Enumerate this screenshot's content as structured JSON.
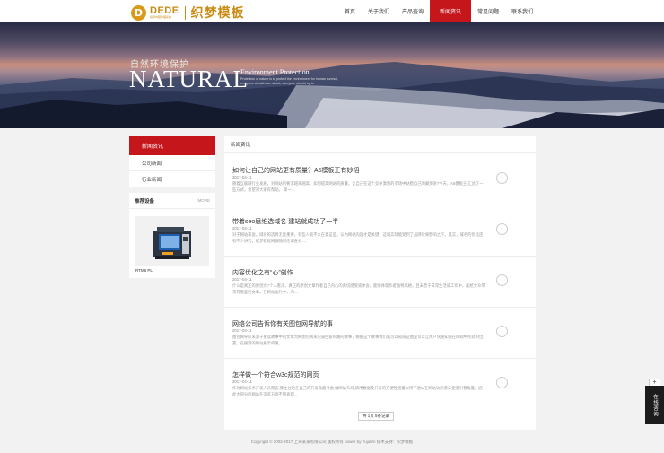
{
  "header": {
    "logo_badge": "D",
    "logo_dede": "DEDE",
    "logo_sub": "织梦内容管理系统",
    "logo_cn": "织梦模板",
    "nav": [
      "首页",
      "关于我们",
      "产品查询",
      "新闻资讯",
      "常见问题",
      "联系我们"
    ],
    "nav_active_index": 3
  },
  "banner": {
    "cn": "自然环境保护",
    "big": "NATURAL",
    "env": "Environment Protection",
    "small": "Protection of nature is to protect the environment for human survival, everyone should care about, everyone should try to"
  },
  "sidebar": {
    "title": "新闻资讯",
    "items": [
      "公司新闻",
      "行业新闻"
    ]
  },
  "recommend": {
    "title": "推荐设备",
    "more": "MORE",
    "product_name": "RTM6 PLI"
  },
  "main": {
    "heading": "新闻资讯",
    "news": [
      {
        "title": "如何让自己的网站更有质量？A5模板王有妙招",
        "date": "2017-04-11",
        "desc": "随着互联网行业发展，对网站的要求越来越高，如何提高网站的质量，让自己在这个竞争激烈的市场中站稳自己的脚步呢?今天，A5模板王 汇总了一些方式，希望对大家有帮助。 第一..."
      },
      {
        "title": "带着seo思维选域名 建站就成功了一半",
        "date": "2017-04-11",
        "desc": "对于网站来说，域名的选择无比重要，有些人就不太在意这些，认为网站内容才是关键，这城实际能受到了品牌效果影响之下。其实，域名的优化还有不少讲究，织梦教程网跟随阿伦调查分...."
      },
      {
        "title": "内容优化之有“心”创作",
        "date": "2017-04-11",
        "desc": "什么是真正的原创文?个人看法，真正的原创文章作者自己内心的真切感受或体会，能够体现作者独特风格，且未曾于日常生活或工作中，能给大众带来可借鉴的文章。在网站运行中，内...."
      },
      {
        "title": "网络公司告诉你有关图包网导航的事",
        "date": "2017-04-11",
        "desc": "图包网导航来源于重读故事中的文章为网图包网来记录回家的路的故事，根据这个故事我们就可以知道这图是可以让用户快速知道在网站中所处的位置，在搜到的网站展示的路，..."
      },
      {
        "title": "怎样做一个符合w3c规范的网页",
        "date": "2017-04-11",
        "desc": "作为网站技术开发人员而言,我往往站在自己的开发角度考虑,做网站布局,请用数据及开发的方便性随着以用不透以在网站访问者与使者引普角度。因此大部分的网站在浏览方面不够直观..."
      }
    ],
    "pager": "共 1页 5条记录"
  },
  "footer": "Copyright © 2002-2017 上海某某有限公司 版权所有 power by Yujufen  技术支持：织梦模板",
  "float": {
    "plus": "+",
    "label": "在线咨询"
  }
}
